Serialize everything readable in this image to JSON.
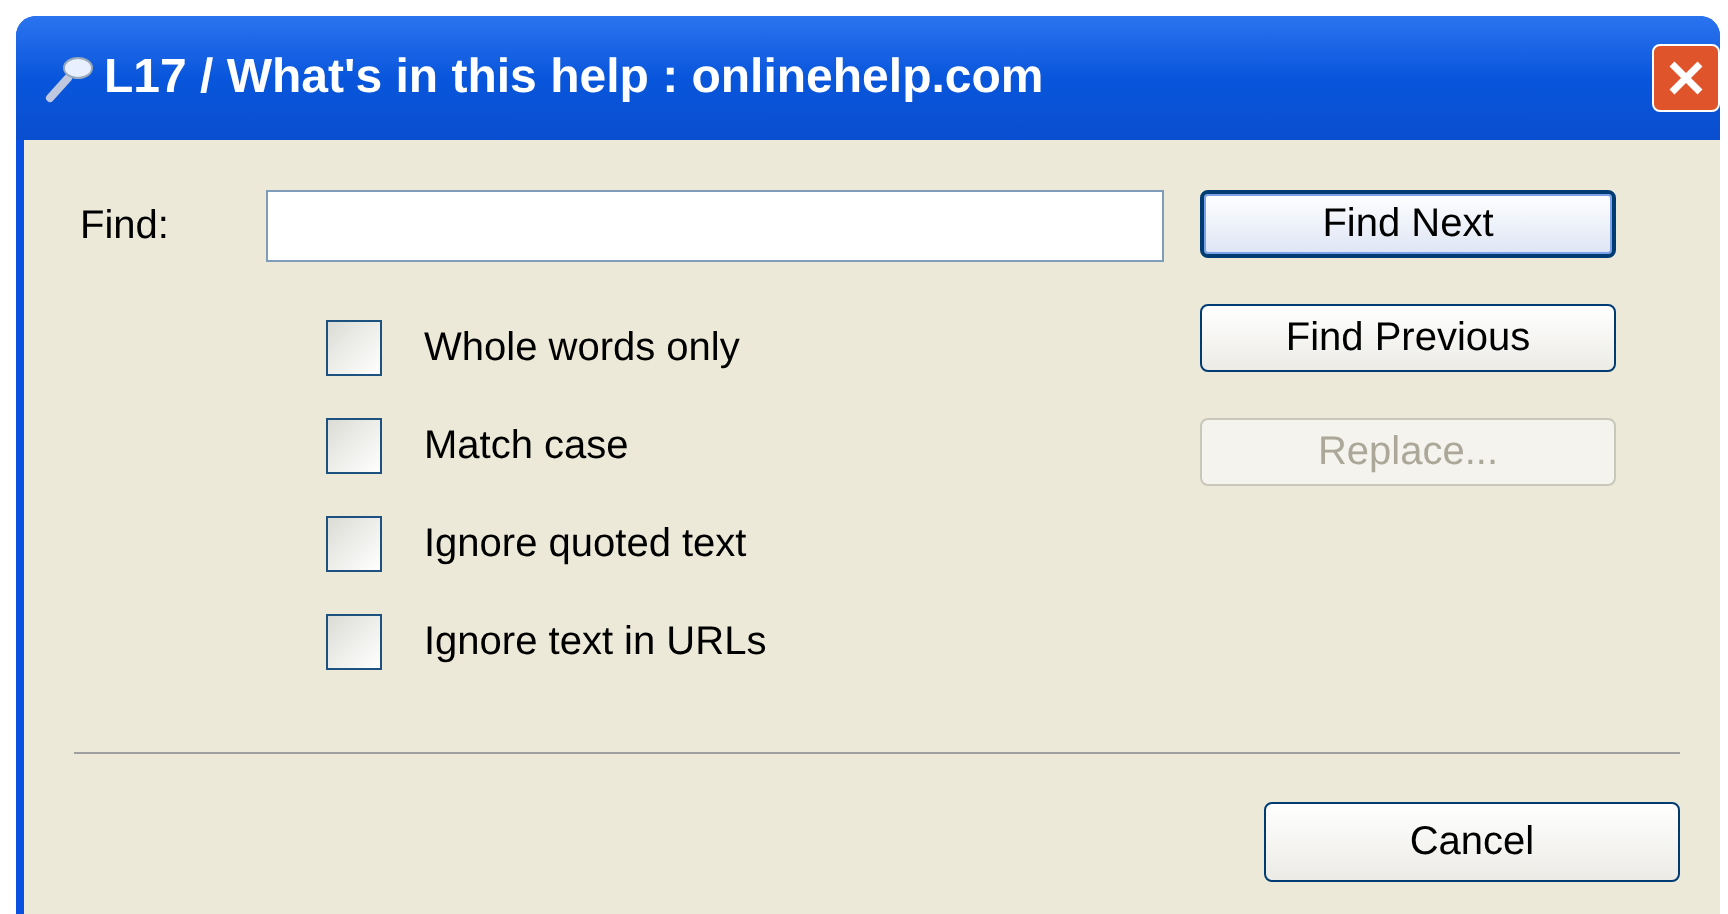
{
  "window": {
    "title": "L17 / What's in this help : onlinehelp.com"
  },
  "find": {
    "label": "Find:"
  },
  "options": [
    {
      "label": "Whole words only",
      "checked": false
    },
    {
      "label": "Match case",
      "checked": false
    },
    {
      "label": "Ignore quoted text",
      "checked": false
    },
    {
      "label": "Ignore text in URLs",
      "checked": false
    }
  ],
  "buttons": [
    {
      "label": "Find Next",
      "disabled": false,
      "default": true
    },
    {
      "label": "Find Previous",
      "disabled": false,
      "default": false
    },
    {
      "label": "Replace...",
      "disabled": true,
      "default": false
    }
  ],
  "cancel": {
    "label": "Cancel"
  }
}
